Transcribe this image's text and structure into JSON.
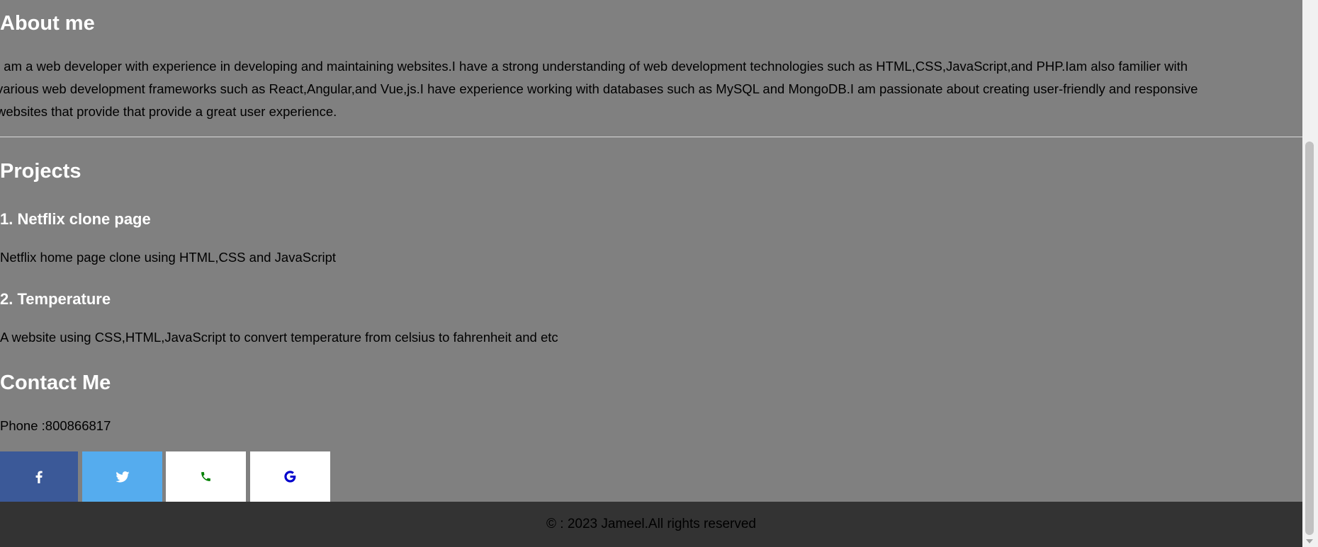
{
  "about": {
    "title": "About me",
    "lines": [
      "I am a web developer with experience in developing and maintaining websites.I have a strong understanding of web development technologies such as HTML,CSS,JavaScript,and PHP.Iam also familier with",
      "various web development frameworks such as React,Angular,and Vue,js.I have experience working with databases such as MySQL and MongoDB.I am passionate about creating user-friendly and responsive",
      "websites that provide that provide a great user experience."
    ]
  },
  "projects": {
    "title": "Projects",
    "items": [
      {
        "title": "1. Netflix clone page",
        "description": "Netflix home page clone using HTML,CSS and JavaScript"
      },
      {
        "title": "2. Temperature",
        "description": "A website using CSS,HTML,JavaScript to convert temperature from celsius to fahrenheit and etc"
      }
    ]
  },
  "contact": {
    "title": "Contact Me",
    "phone": "Phone :800866817",
    "social": [
      {
        "name": "facebook",
        "icon": "facebook-icon",
        "bg": "#3b5998",
        "color": "#ffffff"
      },
      {
        "name": "twitter",
        "icon": "twitter-icon",
        "bg": "#55acee",
        "color": "#ffffff"
      },
      {
        "name": "phone",
        "icon": "phone-icon",
        "bg": "#ffffff",
        "color": "#008000"
      },
      {
        "name": "google",
        "icon": "google-icon",
        "bg": "#ffffff",
        "color": "#0000cc"
      }
    ]
  },
  "footer": {
    "text": "© : 2023 Jameel.All rights reserved"
  },
  "colors": {
    "page_bg": "#808080",
    "footer_bg": "#333333",
    "heading": "#ffffff",
    "text": "#000000"
  }
}
